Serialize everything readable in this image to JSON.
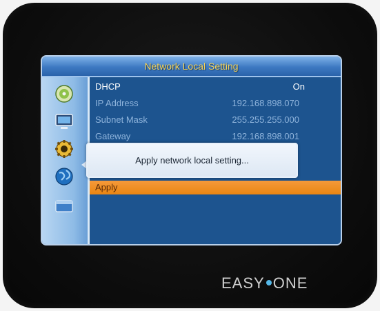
{
  "screen": {
    "title": "Network Local Setting"
  },
  "settings": [
    {
      "label": "DHCP",
      "value": "On"
    },
    {
      "label": "IP Address",
      "value": "192.168.898.070"
    },
    {
      "label": "Subnet Mask",
      "value": "255.255.255.000"
    },
    {
      "label": "Gateway",
      "value": "192.168.898.001"
    }
  ],
  "apply_label": "Apply",
  "dialog": {
    "message": "Apply network local setting..."
  },
  "sidebar": {
    "icons": [
      "disc-icon",
      "monitor-icon",
      "gear-icon",
      "globe-icon",
      "folder-icon"
    ],
    "selected": "gear-icon"
  },
  "brand": {
    "left": "EASY",
    "right": "ONE"
  },
  "colors": {
    "title_text": "#f4d35a",
    "highlight": "#ec8c1e",
    "panel": "#1d548f"
  }
}
